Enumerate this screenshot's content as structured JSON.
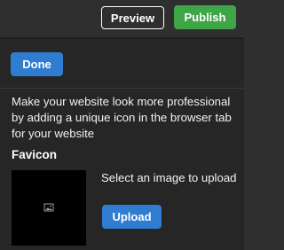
{
  "toolbar": {
    "preview_label": "Preview",
    "publish_label": "Publish"
  },
  "panel": {
    "done_label": "Done",
    "description": "Make your website look more professional by adding a unique icon in the browser tab for your website",
    "favicon_heading": "Favicon",
    "select_text": "Select an image to upload",
    "upload_label": "Upload",
    "preview_icon": "image-placeholder-icon"
  },
  "colors": {
    "publish": "#3fa648",
    "primary": "#2f7dd1",
    "background": "#2f2f2f",
    "panel": "#262626"
  }
}
